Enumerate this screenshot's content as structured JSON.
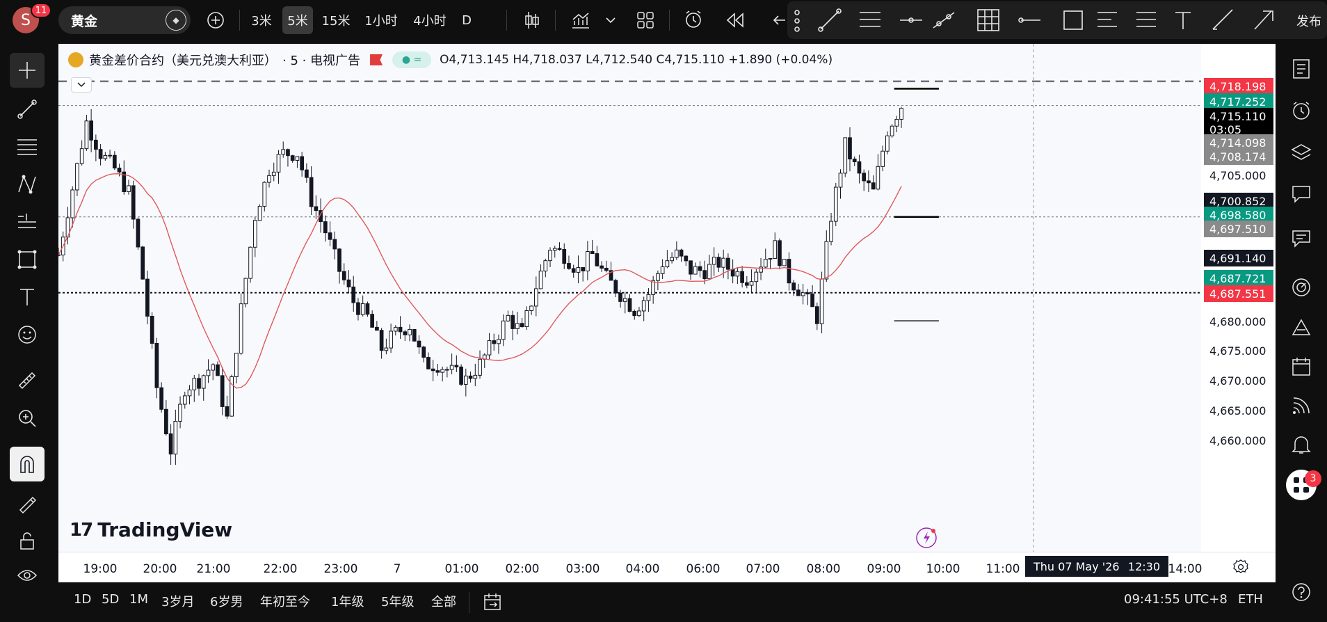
{
  "header": {
    "avatar_letter": "S",
    "avatar_badge": "11",
    "symbol": "黄金",
    "intervals": [
      "3米",
      "5米",
      "15米",
      "1小时",
      "4小时",
      "D"
    ],
    "active_interval": "5米",
    "publish_label": "发布"
  },
  "legend": {
    "title": "黄金差价合约（美元兑澳大利亚）",
    "interval": "· 5 · 电视广告",
    "ohlc": "O4,713.145 H4,718.037 L4,712.540 C4,715.110 +1.890 (+0.04%)"
  },
  "currency": "美元",
  "colors": {
    "up": "#089981",
    "down": "#f23645",
    "ma": "#e05a5a",
    "dark": "#131722"
  },
  "price_labels": [
    {
      "text": "4,718.198",
      "bg": "#f23645",
      "fg": "#ffffff"
    },
    {
      "text": "4,717.252",
      "bg": "#089981",
      "fg": "#ffffff"
    },
    {
      "text": "4,715.110",
      "sub": "03:05",
      "bg": "#000000",
      "fg": "#ffffff"
    },
    {
      "text": "4,714.098",
      "bg": "#8a8a8a",
      "fg": "#ffffff"
    },
    {
      "text": "4,708.174",
      "bg": "#8a8a8a",
      "fg": "#ffffff"
    },
    {
      "text": "4,705.000",
      "bg": "",
      "fg": "#131722"
    },
    {
      "text": "4,700.852",
      "bg": "#131722",
      "fg": "#ffffff"
    },
    {
      "text": "4,698.580",
      "bg": "#089981",
      "fg": "#ffffff"
    },
    {
      "text": "4,697.510",
      "bg": "#8a8a8a",
      "fg": "#ffffff"
    },
    {
      "text": "4,691.140",
      "bg": "#131722",
      "fg": "#ffffff"
    },
    {
      "text": "4,687.721",
      "bg": "#089981",
      "fg": "#ffffff"
    },
    {
      "text": "4,687.551",
      "bg": "#f23645",
      "fg": "#ffffff"
    }
  ],
  "price_ticks": [
    "4,680.000",
    "4,675.000",
    "4,670.000",
    "4,665.000",
    "4,660.000"
  ],
  "time_ticks": [
    "19:00",
    "20:00",
    "21:00",
    "22:00",
    "23:00",
    "7",
    "01:00",
    "02:00",
    "03:00",
    "04:00",
    "06:00",
    "07:00",
    "08:00",
    "09:00",
    "10:00",
    "11:00",
    "14:00"
  ],
  "cursor_time": {
    "date": "Thu 07 May '26",
    "time": "12:30"
  },
  "bottom": {
    "ranges": [
      "1D",
      "5D",
      "1M",
      "3岁月",
      "6岁男",
      "年初至今",
      "1年级",
      "5年级",
      "全部"
    ],
    "clock": "09:41:55 UTC+8",
    "market": "ETH"
  },
  "watermark": "TradingView",
  "alerts_badge": "3",
  "chart_data": {
    "type": "candlestick",
    "interval": "5m",
    "ylim": [
      4658,
      4723
    ],
    "x_range": [
      "18:30",
      "14:20"
    ],
    "moving_average_color": "#e05a5a",
    "close_path": [
      [
        "18:30",
        4696
      ],
      [
        "19:00",
        4713
      ],
      [
        "19:15",
        4709
      ],
      [
        "19:30",
        4707
      ],
      [
        "19:45",
        4704
      ],
      [
        "20:00",
        4693
      ],
      [
        "20:15",
        4679
      ],
      [
        "20:30",
        4671
      ],
      [
        "20:45",
        4679
      ],
      [
        "21:00",
        4680
      ],
      [
        "21:15",
        4682
      ],
      [
        "21:30",
        4675
      ],
      [
        "21:45",
        4689
      ],
      [
        "22:00",
        4701
      ],
      [
        "22:15",
        4707
      ],
      [
        "22:30",
        4709
      ],
      [
        "22:45",
        4709
      ],
      [
        "23:00",
        4703
      ],
      [
        "23:15",
        4699
      ],
      [
        "23:30",
        4694
      ],
      [
        "23:45",
        4690
      ],
      [
        "00:00",
        4688
      ],
      [
        "00:15",
        4684
      ],
      [
        "00:30",
        4686
      ],
      [
        "00:45",
        4687
      ],
      [
        "01:00",
        4682
      ],
      [
        "01:15",
        4682
      ],
      [
        "01:30",
        4681
      ],
      [
        "01:45",
        4680
      ],
      [
        "02:00",
        4682
      ],
      [
        "02:15",
        4685
      ],
      [
        "02:30",
        4688
      ],
      [
        "02:45",
        4686
      ],
      [
        "03:00",
        4692
      ],
      [
        "03:15",
        4697
      ],
      [
        "03:30",
        4696
      ],
      [
        "03:45",
        4694
      ],
      [
        "04:00",
        4696
      ],
      [
        "04:15",
        4693
      ],
      [
        "04:30",
        4691
      ],
      [
        "04:45",
        4689
      ],
      [
        "05:00",
        4691
      ],
      [
        "05:15",
        4695
      ],
      [
        "05:30",
        4696
      ],
      [
        "05:45",
        4694
      ],
      [
        "06:00",
        4694
      ],
      [
        "06:15",
        4695
      ],
      [
        "06:30",
        4694
      ],
      [
        "06:45",
        4693
      ],
      [
        "07:00",
        4695
      ],
      [
        "07:15",
        4697
      ],
      [
        "07:30",
        4693
      ],
      [
        "07:45",
        4691
      ],
      [
        "08:00",
        4688
      ],
      [
        "08:15",
        4701
      ],
      [
        "08:30",
        4710
      ],
      [
        "08:45",
        4706
      ],
      [
        "09:00",
        4704
      ],
      [
        "09:15",
        4712
      ],
      [
        "09:30",
        4715.11
      ]
    ],
    "horizontal_lines": [
      {
        "price": 4718.198,
        "style": "dashed"
      },
      {
        "price": 4715.11,
        "style": "dotted"
      },
      {
        "price": 4700.852,
        "style": "dotted"
      },
      {
        "price": 4691.14,
        "style": "dotted"
      }
    ],
    "drawn_segments": [
      {
        "price": 4717.252,
        "from": "09:00",
        "to": "10:10"
      },
      {
        "price": 4700.852,
        "from": "09:00",
        "to": "10:10"
      },
      {
        "price": 4687.551,
        "from": "09:00",
        "to": "10:10"
      }
    ],
    "last_price": 4715.11
  }
}
